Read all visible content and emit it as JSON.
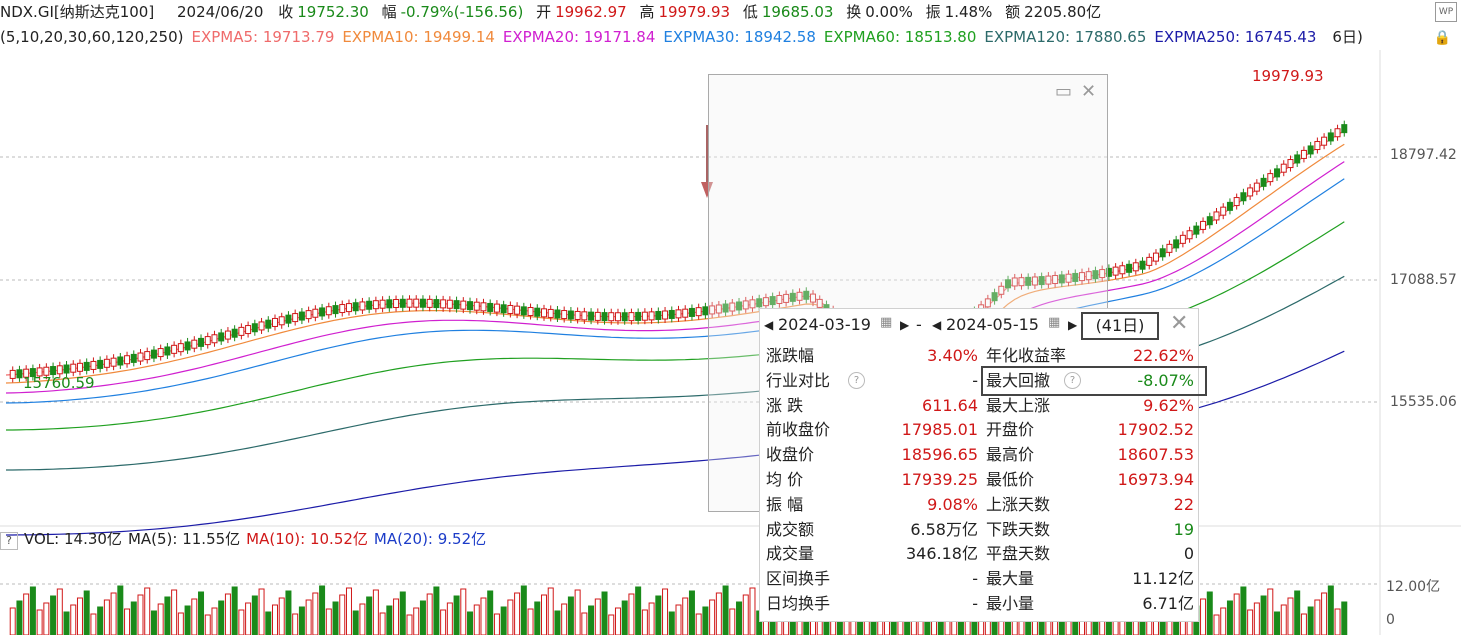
{
  "header": {
    "symbol": "NDX.GI[纳斯达克100]",
    "date": "2024/06/20",
    "close_label": "收",
    "close": "19752.30",
    "change_label": "幅",
    "change": "-0.79%(-156.56)",
    "open_label": "开",
    "open": "19962.97",
    "high_label": "高",
    "high": "19979.93",
    "low_label": "低",
    "low": "19685.03",
    "turnover_label": "换",
    "turnover": "0.00%",
    "amplitude_label": "振",
    "amplitude": "1.48%",
    "amount_label": "额",
    "amount": "2205.80亿",
    "wp_icon": "WP"
  },
  "ma_bar": {
    "params": "(5,10,20,30,60,120,250)",
    "items": [
      {
        "label": "EXPMA5: 19713.79",
        "color": "#ef6b6b"
      },
      {
        "label": "EXPMA10: 19499.14",
        "color": "#f08a3c"
      },
      {
        "label": "EXPMA20: 19171.84",
        "color": "#d020d0"
      },
      {
        "label": "EXPMA30: 18942.58",
        "color": "#2080e0"
      },
      {
        "label": "EXPMA60: 18513.80",
        "color": "#20a020"
      },
      {
        "label": "EXPMA120: 17880.65",
        "color": "#2c6a6a"
      },
      {
        "label": "EXPMA250: 16745.43",
        "color": "#1c1ca8"
      }
    ],
    "tail": "6日)"
  },
  "price_axis": [
    "18797.42",
    "17088.57",
    "15535.06"
  ],
  "annotations": {
    "high_marker": "19979.93",
    "low_marker": "15760.59"
  },
  "vol_bar": {
    "q": "?",
    "vol": "VOL: 14.30亿",
    "ma5": "MA(5): 11.55亿",
    "ma10": "MA(10): 10.52亿",
    "ma20": "MA(20): 9.52亿"
  },
  "vol_axis": [
    "12.00亿",
    "0"
  ],
  "stats_panel": {
    "start_date": "2024-03-19",
    "end_date": "2024-05-15",
    "dash": "-",
    "days": "(41日)",
    "rows": [
      {
        "k1": "涨跌幅",
        "v1": "3.40%",
        "c1": "red",
        "k2": "年化收益率",
        "v2": "22.62%",
        "c2": "red"
      },
      {
        "k1": "行业对比",
        "v1": "-",
        "c1": "",
        "k2": "最大回撤",
        "v2": "-8.07%",
        "c2": "grn"
      },
      {
        "k1": "涨 跌",
        "v1": "611.64",
        "c1": "red",
        "k2": "最大上涨",
        "v2": "9.62%",
        "c2": "red"
      },
      {
        "k1": "前收盘价",
        "v1": "17985.01",
        "c1": "red",
        "k2": "开盘价",
        "v2": "17902.52",
        "c2": "red"
      },
      {
        "k1": "收盘价",
        "v1": "18596.65",
        "c1": "red",
        "k2": "最高价",
        "v2": "18607.53",
        "c2": "red"
      },
      {
        "k1": "均 价",
        "v1": "17939.25",
        "c1": "red",
        "k2": "最低价",
        "v2": "16973.94",
        "c2": "red"
      },
      {
        "k1": "振 幅",
        "v1": "9.08%",
        "c1": "red",
        "k2": "上涨天数",
        "v2": "22",
        "c2": "red"
      },
      {
        "k1": "成交额",
        "v1": "6.58万亿",
        "c1": "",
        "k2": "下跌天数",
        "v2": "19",
        "c2": "grn"
      },
      {
        "k1": "成交量",
        "v1": "346.18亿",
        "c1": "",
        "k2": "平盘天数",
        "v2": "0",
        "c2": ""
      },
      {
        "k1": "区间换手",
        "v1": "-",
        "c1": "",
        "k2": "最大量",
        "v2": "11.12亿",
        "c2": ""
      },
      {
        "k1": "日均换手",
        "v1": "-",
        "c1": "",
        "k2": "最小量",
        "v2": "6.71亿",
        "c2": ""
      }
    ]
  },
  "colors": {
    "up": "#d01818",
    "down": "#1a8a1a"
  }
}
